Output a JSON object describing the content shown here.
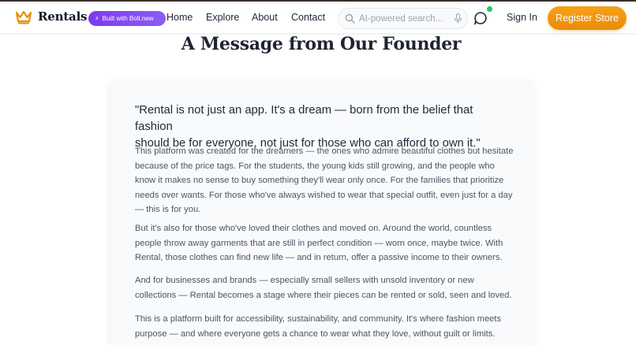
{
  "header": {
    "brand": "Rentals",
    "logo_icon": "crown-icon",
    "badge": "Built with Bolt.new",
    "nav": [
      "Home",
      "Explore",
      "About",
      "Contact"
    ],
    "search": {
      "placeholder": "AI-powered search...",
      "value": ""
    },
    "signin": "Sign In",
    "register": "Register Store"
  },
  "colors": {
    "accent": "#f59e0b",
    "badge": "#7c3aed",
    "online": "#22c55e"
  },
  "page": {
    "title": "A Message from Our Founder"
  },
  "letter": {
    "quote_lines": [
      "\"Rental is not just an app. It's a dream — born from the belief that fashion",
      "should be for everyone, not just for those who can afford to own it.\""
    ],
    "paragraphs": [
      {
        "lines": [
          "This platform was created for the dreamers — the ones who admire beautiful clothes but hesitate",
          "because of the price tags. For the students, the young kids still growing, and the people who",
          "know it makes no sense to buy something they'll wear only once. For the families that prioritize",
          "needs over wants. For those who've always wished to wear that special outfit, even just for a day",
          "— this is for you."
        ]
      },
      {
        "lines": [
          "But it's also for those who've loved their clothes and moved on. Around the world, countless",
          "people throw away garments that are still in perfect condition — worn once, maybe twice. With",
          "Rental, those clothes can find new life — and in return, offer a passive income to their owners."
        ]
      },
      {
        "lines": [
          "And for businesses and brands — especially small sellers with unsold inventory or new",
          "collections — Rental becomes a stage where their pieces can be rented or sold, seen and loved."
        ]
      },
      {
        "lines": [
          "This is a platform built for accessibility, sustainability, and community. It's where fashion meets",
          "purpose — and where everyone gets a chance to wear what they love, without guilt or limits."
        ]
      }
    ]
  }
}
